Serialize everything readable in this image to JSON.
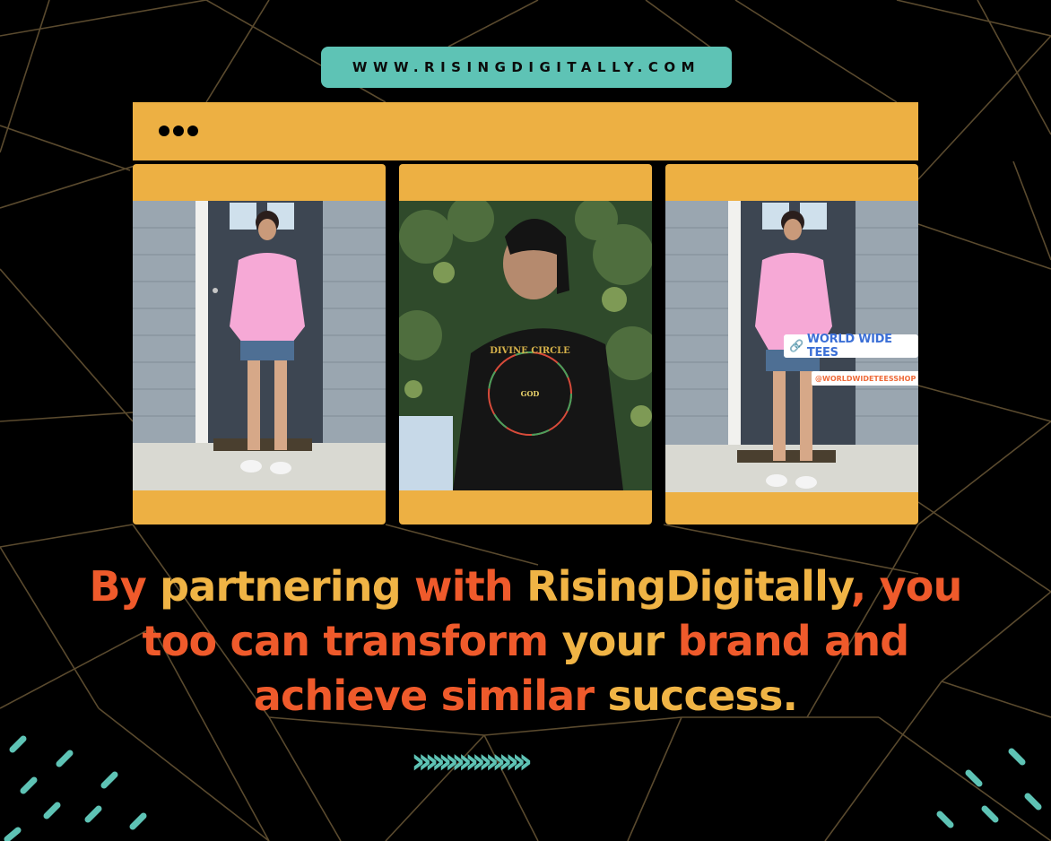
{
  "site": {
    "url": "WWW.RISINGDIGITALLY.COM"
  },
  "browser": {
    "menu_icon": "three-dots-icon"
  },
  "gallery": {
    "photos": [
      {
        "description": "woman-in-pink-hoodie-at-door"
      },
      {
        "description": "woman-in-black-divine-circle-hoodie"
      },
      {
        "description": "woman-in-pink-hoodie-with-shop-tag"
      }
    ],
    "hoodie_print": "DIVINE CIRCLE",
    "hoodie_center": "GOD",
    "shop_tag": "WORLD WIDE TEES",
    "shop_handle": "@WORLDWIDETEESSHOP"
  },
  "headline": {
    "parts": [
      {
        "text": "By ",
        "color": "#ef5a2b"
      },
      {
        "text": "partnering ",
        "color": "#f0b445"
      },
      {
        "text": "with ",
        "color": "#ef5a2b"
      },
      {
        "text": "RisingDigitally",
        "color": "#f0b445"
      },
      {
        "text": ", you",
        "color": "#ef5a2b"
      },
      {
        "text": "too can transform ",
        "color": "#ef5a2b"
      },
      {
        "text": "your ",
        "color": "#f0b445"
      },
      {
        "text": "brand and",
        "color": "#ef5a2b"
      },
      {
        "text": "achieve similar ",
        "color": "#ef5a2b"
      },
      {
        "text": "success.",
        "color": "#f0b445"
      }
    ]
  },
  "decor": {
    "chevrons": "›››››››››››››››››"
  },
  "colors": {
    "background": "#000000",
    "accent_teal": "#5ec3b5",
    "accent_gold": "#edb043",
    "accent_red": "#ef5a2b",
    "line": "#5a4a2e"
  }
}
